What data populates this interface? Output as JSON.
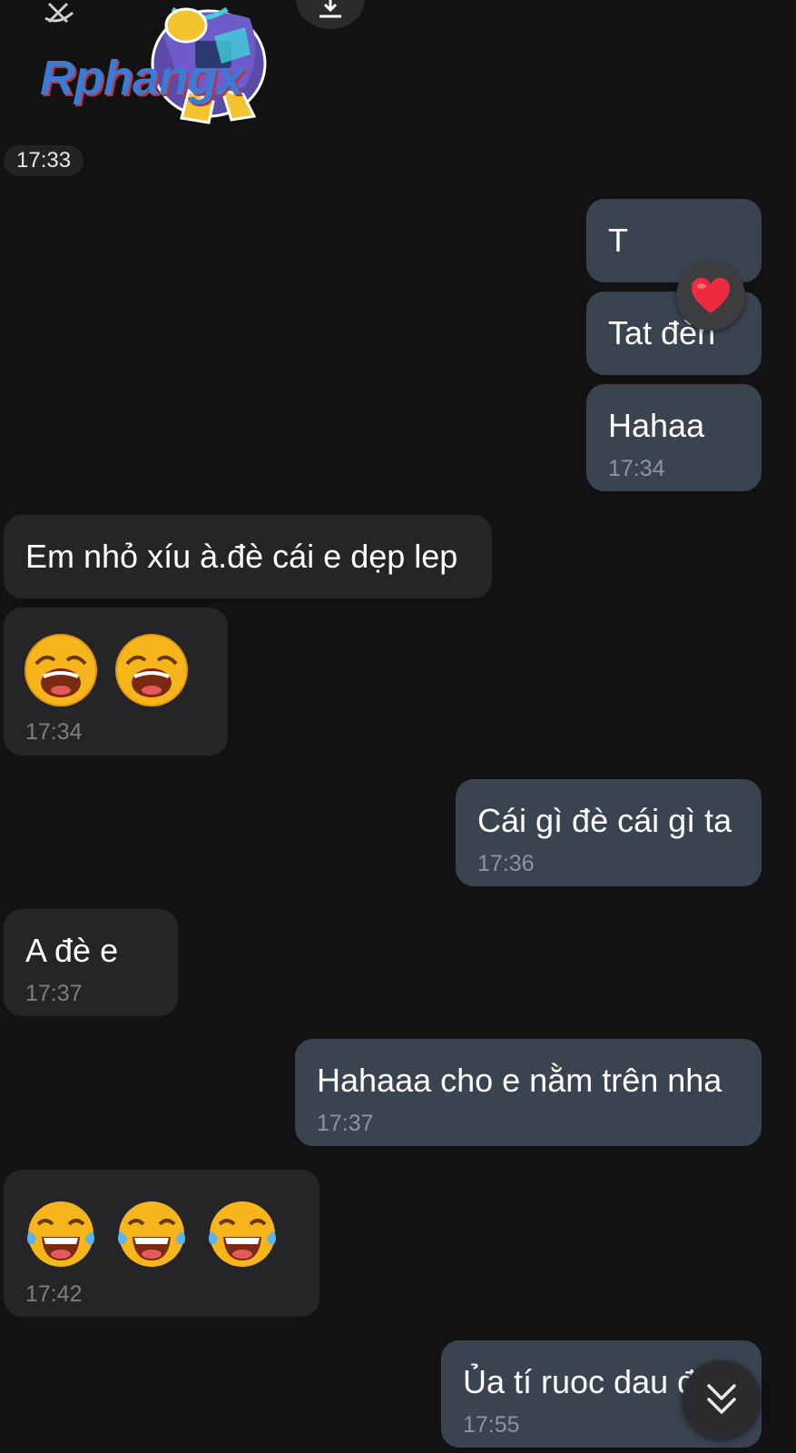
{
  "sticker": {
    "logo_text": "Rphangx",
    "time": "17:33"
  },
  "messages": [
    {
      "direction": "out",
      "text": "T"
    },
    {
      "direction": "out",
      "text": "Tat đèn",
      "reaction": "heart-icon"
    },
    {
      "direction": "out",
      "text": "Hahaa",
      "time": "17:34"
    },
    {
      "direction": "in",
      "text": "Em nhỏ xíu à.đè cái e dẹp lep"
    },
    {
      "direction": "in",
      "emojis": [
        "laughing-face-icon",
        "laughing-face-icon"
      ],
      "time": "17:34"
    },
    {
      "direction": "out",
      "text": "Cái gì đè cái gì ta",
      "time": "17:36"
    },
    {
      "direction": "in",
      "text": "A đè e",
      "time": "17:37"
    },
    {
      "direction": "out",
      "text": "Hahaaa cho e nằm trên nha",
      "time": "17:37"
    },
    {
      "direction": "in",
      "emojis": [
        "tears-of-joy-icon",
        "tears-of-joy-icon",
        "tears-of-joy-icon"
      ],
      "time": "17:42"
    },
    {
      "direction": "out",
      "text": "Ủa tí ruoc dau đ",
      "time": "17:55"
    }
  ],
  "colors": {
    "background": "#121213",
    "outgoing_bubble": "#3a4451",
    "incoming_bubble": "#252527",
    "timestamp": "#8b95a2"
  }
}
